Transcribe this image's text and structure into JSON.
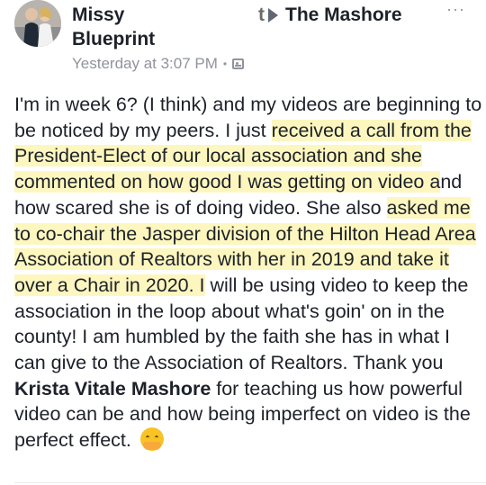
{
  "post": {
    "author": "Missy Blueprint",
    "trail_char": "t",
    "target": "The Mashore",
    "more_label": "···",
    "timestamp": "Yesterday at 3:07 PM",
    "separator": "•",
    "privacy_icon": "group-privacy-icon",
    "segments": {
      "s1": "I'm in week 6? (I think) and my videos are beginning to be noticed by my peers. I just ",
      "s2": "received a call from the President-Elect of our local association and she commented on how good I was getting on video a",
      "s3": "nd how scared she is of doing video. She also ",
      "s4": "asked me to co-chair the Jasper division of the Hilton Head Area Association of Realtors with her in 2019 and take it over a Chair in 2020. I",
      "s5": " will be using video to keep the association in the loop about what's goin' on in the county! I am humbled by the faith she has in what I can give to the Association of Realtors. Thank you ",
      "mention": "Krista Vitale Mashore",
      "s6": " for teaching us how powerful video can be and how being imperfect on video is the perfect effect. "
    },
    "emoji": "hugging-face-emoji",
    "highlight_color": "#fdf7bf"
  }
}
